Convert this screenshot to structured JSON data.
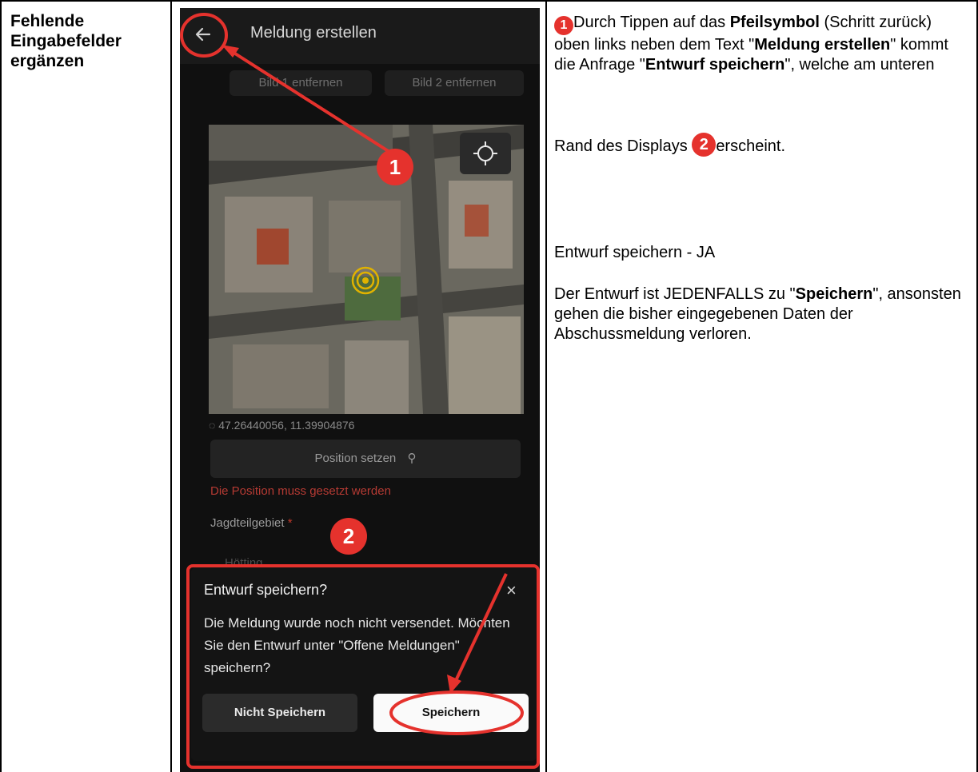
{
  "left": {
    "heading": "Fehlende Eingabefelder ergänzen"
  },
  "phone": {
    "title": "Meldung erstellen",
    "back_icon": "arrow-left-icon",
    "ghost_buttons": [
      "Bild 1 entfernen",
      "Bild 2 entfernen"
    ],
    "coordinates": "47.26440056, 11.39904876",
    "position_button": "Position setzen",
    "position_error": "Die Position muss gesetzt werden",
    "field_label": "Jagdteilgebiet",
    "field_required": "*",
    "field_value": "Hötting",
    "dialog": {
      "title": "Entwurf speichern?",
      "close": "×",
      "body": "Die Meldung wurde noch nicht versendet. Möchten Sie den Entwurf unter \"Offene Meldungen\" speichern?",
      "btn_cancel": "Nicht Speichern",
      "btn_save": "Speichern"
    },
    "markers": [
      "1",
      "2"
    ]
  },
  "right": {
    "badge1": "1",
    "badge2": "2",
    "p1_a": "Durch Tippen auf das ",
    "p1_b": "Pfeilsymbol",
    "p1_c": " (Schritt zurück) oben links neben dem Text \"",
    "p1_d": "Meldung erstellen",
    "p1_e": "\" kommt die Anfrage \"",
    "p1_f": "Entwurf speichern",
    "p1_g": "\", welche am unteren",
    "p1_h": "Rand des Displays ",
    "p1_i": "erscheint.",
    "p2": "Entwurf speichern - JA",
    "p3_a": "Der Entwurf ist JEDENFALLS zu \"",
    "p3_b": "Speichern",
    "p3_c": "\", ansonsten gehen die bisher eingegebenen Daten der Abschussmeldung verloren."
  },
  "colors": {
    "accent": "#e5322d",
    "screen_bg": "#101010",
    "error": "#b53a33"
  }
}
